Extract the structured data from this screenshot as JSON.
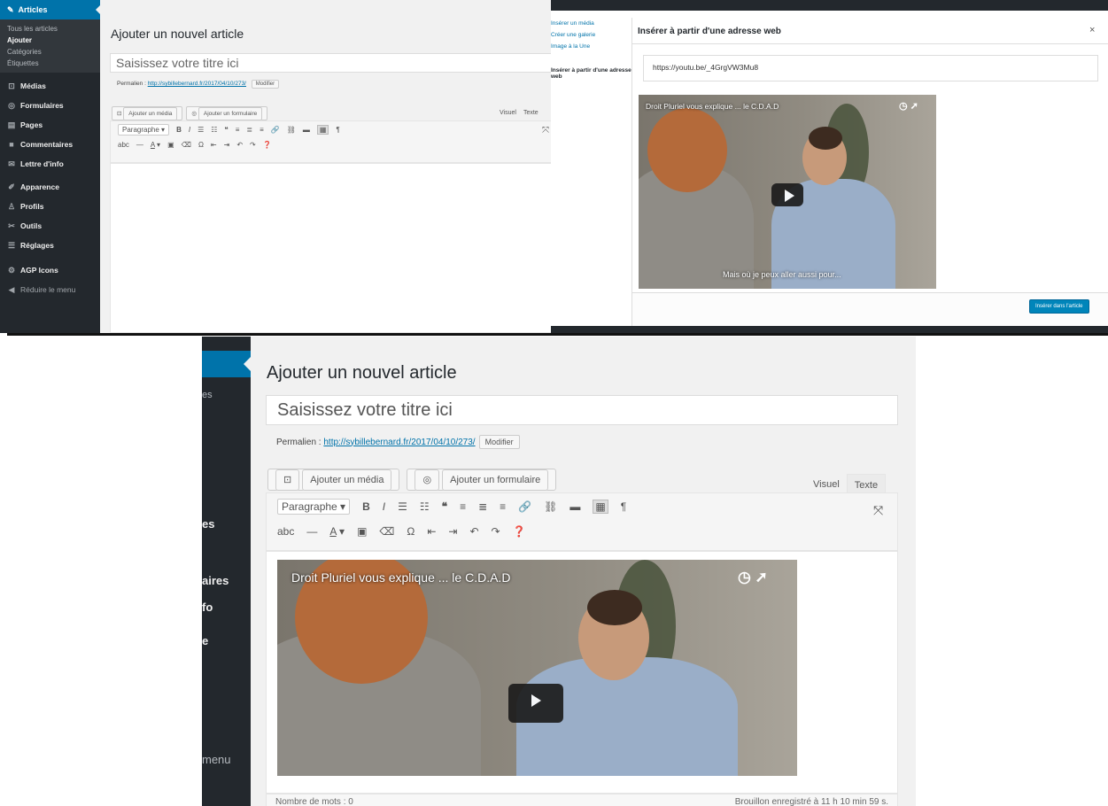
{
  "panel1": {
    "sidebar": {
      "articles_label": "Articles",
      "sub_items": [
        "Tous les articles",
        "Ajouter",
        "Catégories",
        "Étiquettes"
      ],
      "items": [
        {
          "label": "Médias",
          "icon": "media-icon"
        },
        {
          "label": "Formulaires",
          "icon": "form-icon"
        },
        {
          "label": "Pages",
          "icon": "pages-icon"
        },
        {
          "label": "Commentaires",
          "icon": "comments-icon"
        },
        {
          "label": "Lettre d'info",
          "icon": "newsletter-icon"
        },
        {
          "label": "Apparence",
          "icon": "appearance-icon"
        },
        {
          "label": "Profils",
          "icon": "profile-icon"
        },
        {
          "label": "Outils",
          "icon": "tools-icon"
        },
        {
          "label": "Réglages",
          "icon": "settings-icon"
        },
        {
          "label": "AGP Icons",
          "icon": "agp-icon"
        },
        {
          "label": "Réduire le menu",
          "icon": "collapse-icon"
        }
      ]
    },
    "page_title": "Ajouter un nouvel article",
    "title_placeholder": "Saisissez votre titre ici",
    "permalink_label": "Permalien :",
    "permalink_url": "http://sybillebernard.fr/2017/04/10/273/",
    "modify_button": "Modifier",
    "add_media_button": "Ajouter un média",
    "add_form_button": "Ajouter un formulaire",
    "tab_visual": "Visuel",
    "tab_text": "Texte",
    "format_select": "Paragraphe"
  },
  "panel2": {
    "left_links": [
      "Insérer un média",
      "Créer une galerie",
      "Image à la Une"
    ],
    "left_current": "Insérer à partir d'une adresse web",
    "modal_title": "Insérer à partir d'une adresse web",
    "close_label": "×",
    "url_value": "https://youtu.be/_4GrgVW3Mu8",
    "video_title": "Droit Pluriel vous explique ... le C.D.A.D",
    "video_subtitle": "Mais où je peux aller aussi pour...",
    "insert_button": "Insérer dans l'article"
  },
  "panel3": {
    "sidebar_fragments": [
      "es",
      "es",
      "aires",
      "fo",
      "e",
      "menu"
    ],
    "page_title": "Ajouter un nouvel article",
    "title_placeholder": "Saisissez votre titre ici",
    "permalink_label": "Permalien :",
    "permalink_url": "http://sybillebernard.fr/2017/04/10/273/",
    "modify_button": "Modifier",
    "add_media_button": "Ajouter un média",
    "add_form_button": "Ajouter un formulaire",
    "tab_visual": "Visuel",
    "tab_text": "Texte",
    "format_select": "Paragraphe",
    "video_title": "Droit Pluriel vous explique ... le C.D.A.D",
    "word_count": "Nombre de mots : 0",
    "draft_saved": "Brouillon enregistré à 11 h 10 min 59 s."
  },
  "toolbar_icons": {
    "row1": [
      "bold-icon",
      "italic-icon",
      "bullet-list-icon",
      "numbered-list-icon",
      "blockquote-icon",
      "align-left-icon",
      "align-center-icon",
      "align-right-icon",
      "link-icon",
      "unlink-icon",
      "read-more-icon",
      "toolbar-toggle-icon",
      "text-direction-icon",
      "fullscreen-icon"
    ],
    "row2": [
      "strikethrough-icon",
      "horizontal-line-icon",
      "text-color-icon",
      "paste-text-icon",
      "clear-formatting-icon",
      "special-char-icon",
      "outdent-icon",
      "indent-icon",
      "undo-icon",
      "redo-icon",
      "help-icon"
    ]
  },
  "colors": {
    "admin_bar": "#23282d",
    "accent_blue": "#0073aa",
    "primary_button": "#0085ba",
    "page_bg": "#f1f1f1"
  }
}
